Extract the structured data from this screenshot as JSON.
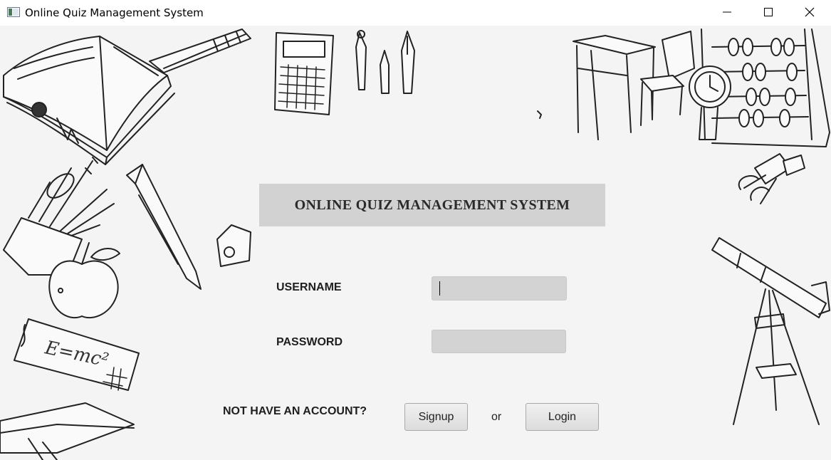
{
  "window": {
    "title": "Online Quiz Management System",
    "icon": "java-app-icon",
    "controls": [
      "minimize-icon",
      "maximize-icon",
      "close-icon"
    ]
  },
  "form": {
    "heading": "ONLINE QUIZ MANAGEMENT SYSTEM",
    "username_label": "USERNAME",
    "username_value": "",
    "password_label": "PASSWORD",
    "password_value": "",
    "no_account_label": "NOT HAVE AN ACCOUNT?",
    "signup_label": "Signup",
    "or_text": "or",
    "login_label": "Login"
  },
  "background": {
    "doodles": [
      "open-book",
      "knife",
      "calculator",
      "pens",
      "desk-chair",
      "clock",
      "abacus",
      "pencil-cup",
      "pencil",
      "sharpener",
      "binder-clips",
      "apple",
      "telescope",
      "closed-book",
      "notebook"
    ],
    "formula_text": "E=mc²"
  },
  "colors": {
    "background": "#f4f4f4",
    "header_box": "#d2d2d2",
    "field": "#d3d3d3"
  }
}
